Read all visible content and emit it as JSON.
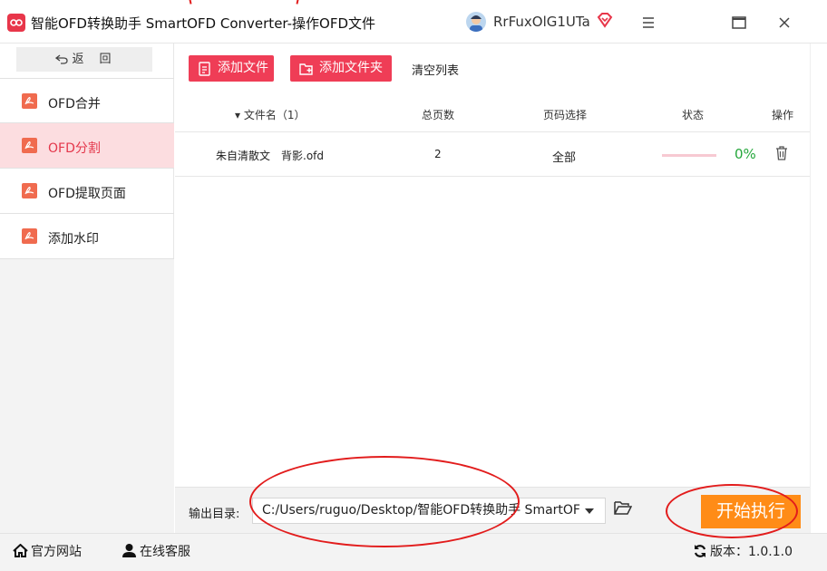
{
  "window": {
    "title": "智能OFD转换助手 SmartOFD Converter-操作OFD文件",
    "user_name": "RrFuxOlG1UTa"
  },
  "sidebar": {
    "back_label": "返　回",
    "items": [
      {
        "label": "OFD合并",
        "active": false
      },
      {
        "label": "OFD分割",
        "active": true
      },
      {
        "label": "OFD提取页面",
        "active": false
      },
      {
        "label": "添加水印",
        "active": false
      }
    ]
  },
  "toolbar": {
    "add_file_label": "添加文件",
    "add_folder_label": "添加文件夹",
    "clear_list_label": "清空列表"
  },
  "table": {
    "headers": {
      "name": "▾ 文件名（1）",
      "pages": "总页数",
      "range": "页码选择",
      "status": "状态",
      "ops": "操作"
    },
    "rows": [
      {
        "filename": "朱自清散文　背影.ofd",
        "pages": "2",
        "range": "全部",
        "progress": 0,
        "percent": "0%"
      }
    ]
  },
  "output": {
    "label": "输出目录:",
    "path": "C:/Users/ruguo/Desktop/智能OFD转换助手 SmartOF"
  },
  "start_label": "开始执行",
  "footer": {
    "website_label": "官方网站",
    "support_label": "在线客服",
    "version_label": "版本：1.0.1.0"
  },
  "colors": {
    "accent": "#ef3d56",
    "active_bg": "#fcdde0",
    "start_button": "#ff8c17",
    "percent": "#25a73c",
    "annotation": "#e21c1c"
  },
  "icons": {
    "app_logo": "app-logo-icon",
    "back": "back-arrow-icon",
    "nav": "pdf-file-icon",
    "add_file": "add-file-icon",
    "add_folder": "add-folder-icon",
    "delete": "trash-icon",
    "folder": "folder-open-icon",
    "website": "home-icon",
    "support": "support-agent-icon",
    "refresh": "refresh-icon"
  }
}
